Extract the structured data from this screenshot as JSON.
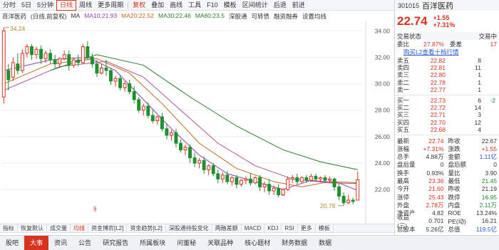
{
  "toolbar": {
    "items": [
      "分时",
      "5日",
      "5分钟",
      "日线",
      "周线",
      "更多周期",
      "复权",
      "叠加",
      "画线",
      "工具",
      "F10",
      "模板",
      "区间统计",
      "后退",
      "前进"
    ],
    "active": "日线",
    "fq_label": "复权",
    "overlay_label": "叠加"
  },
  "chart_info": {
    "stock": "百洋医药",
    "mode": "(日线,前复权)",
    "ma": "MA",
    "ma10": "MA10:21.93",
    "ma20": "MA20:22.52",
    "ma30": "MA30:22.46",
    "ma60": "MA60:23.5",
    "toolbar2": [
      "深股通",
      "可转债",
      "融资融券",
      "设置均线"
    ]
  },
  "chart_data": {
    "type": "candlestick",
    "y_ticks": [
      "34.00",
      "32.00",
      "30.00",
      "28.00",
      "26.00",
      "24.00",
      "22.00"
    ],
    "ylim": [
      20.5,
      34.5
    ],
    "high_label": "34.24",
    "low_label": "20.78",
    "candles": [
      {
        "o": 29.0,
        "h": 34.24,
        "c": 34.0,
        "l": 28.5
      },
      {
        "o": 31.0,
        "h": 31.5,
        "c": 30.3,
        "l": 29.5
      },
      {
        "o": 30.5,
        "h": 32.0,
        "c": 31.6,
        "l": 30.2
      },
      {
        "o": 31.5,
        "h": 32.3,
        "c": 31.0,
        "l": 30.7
      },
      {
        "o": 31.0,
        "h": 32.6,
        "c": 32.3,
        "l": 30.8
      },
      {
        "o": 32.3,
        "h": 33.0,
        "c": 32.8,
        "l": 32.0
      },
      {
        "o": 32.8,
        "h": 33.0,
        "c": 32.2,
        "l": 31.8
      },
      {
        "o": 32.2,
        "h": 32.8,
        "c": 32.6,
        "l": 31.9
      },
      {
        "o": 32.6,
        "h": 32.9,
        "c": 31.9,
        "l": 31.5
      },
      {
        "o": 31.9,
        "h": 32.5,
        "c": 32.3,
        "l": 31.6
      },
      {
        "o": 32.3,
        "h": 32.6,
        "c": 31.8,
        "l": 31.5
      },
      {
        "o": 31.8,
        "h": 32.2,
        "c": 31.5,
        "l": 31.2
      },
      {
        "o": 31.5,
        "h": 32.0,
        "c": 31.9,
        "l": 31.3
      },
      {
        "o": 31.9,
        "h": 32.5,
        "c": 32.2,
        "l": 31.8
      },
      {
        "o": 32.2,
        "h": 32.5,
        "c": 31.4,
        "l": 31.0
      },
      {
        "o": 31.4,
        "h": 32.0,
        "c": 31.8,
        "l": 31.2
      },
      {
        "o": 31.8,
        "h": 32.2,
        "c": 31.6,
        "l": 31.3
      },
      {
        "o": 31.6,
        "h": 33.0,
        "c": 32.8,
        "l": 31.5
      },
      {
        "o": 32.8,
        "h": 33.2,
        "c": 32.0,
        "l": 31.8
      },
      {
        "o": 32.0,
        "h": 32.3,
        "c": 31.5,
        "l": 31.2
      },
      {
        "o": 31.5,
        "h": 31.8,
        "c": 30.8,
        "l": 30.5
      },
      {
        "o": 30.8,
        "h": 31.5,
        "c": 31.2,
        "l": 30.7
      },
      {
        "o": 31.2,
        "h": 31.8,
        "c": 31.0,
        "l": 30.6
      },
      {
        "o": 31.0,
        "h": 31.2,
        "c": 30.2,
        "l": 29.9
      },
      {
        "o": 30.2,
        "h": 30.6,
        "c": 30.4,
        "l": 29.8
      },
      {
        "o": 30.4,
        "h": 30.7,
        "c": 29.7,
        "l": 29.5
      },
      {
        "o": 29.7,
        "h": 30.2,
        "c": 30.0,
        "l": 29.4
      },
      {
        "o": 30.0,
        "h": 30.3,
        "c": 29.4,
        "l": 29.2
      },
      {
        "o": 29.4,
        "h": 29.8,
        "c": 28.8,
        "l": 28.5
      },
      {
        "o": 28.8,
        "h": 29.0,
        "c": 28.0,
        "l": 27.8
      },
      {
        "o": 28.0,
        "h": 28.5,
        "c": 28.3,
        "l": 27.6
      },
      {
        "o": 28.3,
        "h": 28.6,
        "c": 27.6,
        "l": 27.4
      },
      {
        "o": 27.6,
        "h": 28.0,
        "c": 27.2,
        "l": 27.0
      },
      {
        "o": 27.2,
        "h": 27.6,
        "c": 27.5,
        "l": 26.9
      },
      {
        "o": 27.5,
        "h": 27.8,
        "c": 26.6,
        "l": 26.4
      },
      {
        "o": 26.6,
        "h": 27.0,
        "c": 26.1,
        "l": 25.8
      },
      {
        "o": 26.1,
        "h": 26.5,
        "c": 26.3,
        "l": 25.7
      },
      {
        "o": 26.3,
        "h": 26.6,
        "c": 25.5,
        "l": 25.2
      },
      {
        "o": 25.5,
        "h": 25.8,
        "c": 25.0,
        "l": 24.8
      },
      {
        "o": 25.0,
        "h": 25.4,
        "c": 25.2,
        "l": 24.6
      },
      {
        "o": 25.2,
        "h": 25.4,
        "c": 24.4,
        "l": 24.0
      },
      {
        "o": 24.4,
        "h": 24.8,
        "c": 24.0,
        "l": 23.7
      },
      {
        "o": 24.0,
        "h": 24.4,
        "c": 24.2,
        "l": 23.6
      },
      {
        "o": 24.2,
        "h": 24.5,
        "c": 23.5,
        "l": 23.2
      },
      {
        "o": 23.5,
        "h": 23.9,
        "c": 23.8,
        "l": 23.1
      },
      {
        "o": 23.8,
        "h": 24.0,
        "c": 23.2,
        "l": 23.0
      },
      {
        "o": 23.2,
        "h": 23.5,
        "c": 22.8,
        "l": 22.5
      },
      {
        "o": 22.8,
        "h": 23.3,
        "c": 23.1,
        "l": 22.5
      },
      {
        "o": 23.1,
        "h": 23.4,
        "c": 22.6,
        "l": 22.4
      },
      {
        "o": 22.6,
        "h": 23.0,
        "c": 22.9,
        "l": 22.3
      },
      {
        "o": 22.9,
        "h": 23.1,
        "c": 22.4,
        "l": 22.1
      },
      {
        "o": 22.4,
        "h": 22.8,
        "c": 22.7,
        "l": 22.2
      },
      {
        "o": 22.7,
        "h": 23.0,
        "c": 22.8,
        "l": 22.4
      },
      {
        "o": 22.8,
        "h": 23.2,
        "c": 22.5,
        "l": 22.3
      },
      {
        "o": 22.5,
        "h": 23.0,
        "c": 22.9,
        "l": 22.4
      },
      {
        "o": 22.9,
        "h": 23.1,
        "c": 22.2,
        "l": 21.9
      },
      {
        "o": 22.2,
        "h": 22.6,
        "c": 22.4,
        "l": 21.8
      },
      {
        "o": 22.4,
        "h": 22.8,
        "c": 21.9,
        "l": 21.6
      },
      {
        "o": 21.9,
        "h": 22.3,
        "c": 22.1,
        "l": 21.6
      },
      {
        "o": 22.1,
        "h": 22.4,
        "c": 21.6,
        "l": 21.4
      },
      {
        "o": 21.6,
        "h": 22.1,
        "c": 22.0,
        "l": 21.5
      },
      {
        "o": 22.0,
        "h": 23.0,
        "c": 22.8,
        "l": 21.9
      },
      {
        "o": 22.8,
        "h": 23.1,
        "c": 22.9,
        "l": 22.5
      },
      {
        "o": 22.9,
        "h": 23.2,
        "c": 22.6,
        "l": 22.4
      },
      {
        "o": 22.6,
        "h": 23.0,
        "c": 22.9,
        "l": 22.5
      },
      {
        "o": 22.9,
        "h": 23.1,
        "c": 22.7,
        "l": 22.5
      },
      {
        "o": 22.7,
        "h": 23.2,
        "c": 23.0,
        "l": 22.6
      },
      {
        "o": 23.0,
        "h": 23.2,
        "c": 22.8,
        "l": 22.6
      },
      {
        "o": 22.8,
        "h": 23.0,
        "c": 22.9,
        "l": 22.6
      },
      {
        "o": 22.9,
        "h": 23.1,
        "c": 22.7,
        "l": 22.5
      },
      {
        "o": 22.7,
        "h": 23.0,
        "c": 22.8,
        "l": 22.5
      },
      {
        "o": 22.8,
        "h": 22.9,
        "c": 22.2,
        "l": 21.9
      },
      {
        "o": 22.2,
        "h": 22.5,
        "c": 21.5,
        "l": 21.2
      },
      {
        "o": 21.5,
        "h": 21.8,
        "c": 21.0,
        "l": 20.78
      },
      {
        "o": 21.0,
        "h": 21.6,
        "c": 21.2,
        "l": 20.9
      },
      {
        "o": 21.2,
        "h": 21.4,
        "c": 21.1,
        "l": 20.9
      },
      {
        "o": 21.2,
        "h": 23.36,
        "c": 22.74,
        "l": 21.6
      }
    ],
    "ma_series": [
      {
        "name": "MA10",
        "color": "#9c3fb5",
        "values": [
          [
            0,
            31.0
          ],
          [
            10,
            31.8
          ],
          [
            18,
            32.0
          ],
          [
            24,
            31.0
          ],
          [
            30,
            28.8
          ],
          [
            36,
            26.6
          ],
          [
            42,
            24.6
          ],
          [
            48,
            23.2
          ],
          [
            54,
            22.6
          ],
          [
            60,
            22.0
          ],
          [
            66,
            22.7
          ],
          [
            72,
            22.5
          ],
          [
            76,
            21.93
          ]
        ]
      },
      {
        "name": "MA20",
        "color": "#c46b23",
        "values": [
          [
            0,
            30.0
          ],
          [
            10,
            31.5
          ],
          [
            20,
            31.9
          ],
          [
            27,
            30.8
          ],
          [
            34,
            28.5
          ],
          [
            42,
            25.5
          ],
          [
            50,
            23.6
          ],
          [
            58,
            22.6
          ],
          [
            64,
            22.2
          ],
          [
            70,
            22.6
          ],
          [
            76,
            22.52
          ]
        ]
      },
      {
        "name": "MA30",
        "color": "#b3558a",
        "values": [
          [
            0,
            29.5
          ],
          [
            12,
            31.3
          ],
          [
            22,
            31.7
          ],
          [
            30,
            30.5
          ],
          [
            38,
            28.0
          ],
          [
            46,
            25.5
          ],
          [
            54,
            23.8
          ],
          [
            62,
            22.8
          ],
          [
            70,
            22.5
          ],
          [
            76,
            22.46
          ]
        ]
      },
      {
        "name": "MA60",
        "color": "#2b7b2b",
        "values": [
          [
            10,
            31.0
          ],
          [
            20,
            32.2
          ],
          [
            30,
            31.4
          ],
          [
            40,
            29.0
          ],
          [
            50,
            26.8
          ],
          [
            60,
            25.0
          ],
          [
            68,
            24.1
          ],
          [
            76,
            23.5
          ]
        ]
      }
    ]
  },
  "ind_tabs": [
    "指标",
    "恢复默认",
    "成交量",
    "均线",
    "资金博弈[L2]",
    "资金趋势[L2]",
    "深股通持股变化",
    "两融差额",
    "MACD",
    "KDJ",
    "RSI",
    "更多",
    "模板"
  ],
  "ind_tabs_active": "均线",
  "bottom_tabs": [
    "股吧",
    "大事",
    "资讯",
    "公告",
    "研究报告",
    "所属板块",
    "问董秘",
    "关联品种",
    "核心题材",
    "财务数据",
    "数据"
  ],
  "bottom_tabs_active": "大事",
  "quote": {
    "code": "301015",
    "name": "百洋医药",
    "price": "22.74",
    "chg": "+1.55",
    "pct": "+7.31%",
    "status_label": "交易状态",
    "status_value": "交易中",
    "weibi_label": "委比",
    "weibi_value": "27.87%",
    "weicha_label": "委差",
    "weicha_value": "17",
    "l2_link": "购买L2查看十档行情",
    "asks": [
      {
        "label": "卖五",
        "price": "22.82",
        "vol": "8",
        "diff": ""
      },
      {
        "label": "卖四",
        "price": "22.81",
        "vol": "11",
        "diff": ""
      },
      {
        "label": "卖三",
        "price": "22.80",
        "vol": "1",
        "diff": ""
      },
      {
        "label": "卖二",
        "price": "22.78",
        "vol": "1",
        "diff": ""
      },
      {
        "label": "卖一",
        "price": "22.77",
        "vol": "1",
        "diff": ""
      }
    ],
    "bids": [
      {
        "label": "买一",
        "price": "22.73",
        "vol": "6",
        "diff": "-2"
      },
      {
        "label": "买二",
        "price": "22.72",
        "vol": "14",
        "diff": ""
      },
      {
        "label": "买三",
        "price": "22.71",
        "vol": "3",
        "diff": ""
      },
      {
        "label": "买四",
        "price": "22.70",
        "vol": "12",
        "diff": ""
      },
      {
        "label": "买五",
        "price": "22.68",
        "vol": "4",
        "diff": ""
      }
    ],
    "stats": [
      [
        "最新",
        "22.74",
        "昨收",
        "22.67"
      ],
      [
        "涨幅",
        "+7.31%",
        "涨跌",
        "+1.55"
      ],
      [
        "总手",
        "4.88万",
        "金额",
        "1.11亿"
      ],
      [
        "盘后量",
        "0",
        "盘后额",
        "0"
      ],
      [
        "换手",
        "0.93%",
        "量比",
        "3.90"
      ],
      [
        "最高",
        "23.36",
        "最低",
        "21.45"
      ],
      [
        "今开",
        "21.60",
        "昨收",
        "21.19"
      ],
      [
        "涨停",
        "25.43",
        "跌停",
        "16.95"
      ],
      [
        "外盘",
        "2.78万",
        "内盘",
        "2.11万"
      ],
      [
        "净资产",
        "4.82",
        "ROE",
        "13.24%"
      ],
      [
        "收益(三)",
        "0.701",
        "PE(动)",
        "16.21"
      ],
      [
        "总股本",
        "5.26亿",
        "总值",
        "119.5亿"
      ]
    ]
  }
}
